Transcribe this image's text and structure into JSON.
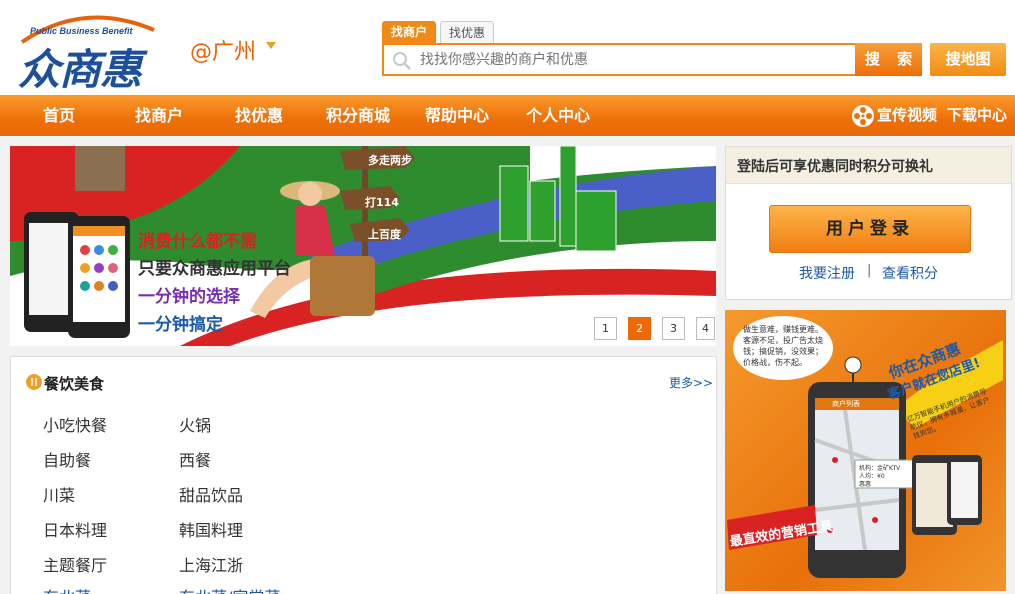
{
  "logo": {
    "english": "Public Business Benefit",
    "chinese": "众商惠"
  },
  "city": {
    "label": "@广州"
  },
  "search": {
    "tabs": [
      {
        "label": "找商户",
        "active": true
      },
      {
        "label": "找优惠",
        "active": false
      }
    ],
    "placeholder": "找找你感兴趣的商户和优惠",
    "button": "搜 索",
    "map_button": "搜地图"
  },
  "nav": {
    "items": [
      "首页",
      "找商户",
      "找优惠",
      "积分商城",
      "帮助中心",
      "个人中心"
    ],
    "right": {
      "video": "宣传视频",
      "download": "下载中心"
    }
  },
  "banner": {
    "signs": [
      "多走两步",
      "打114",
      "上百度"
    ],
    "lines": [
      "消费什么都不需",
      "只要众商惠应用平台",
      "一分钟的选择",
      "一分钟搞定"
    ],
    "pager": [
      "1",
      "2",
      "3",
      "4"
    ],
    "active_page": "2"
  },
  "category": {
    "title": "餐饮美食",
    "more": "更多>>",
    "items": [
      [
        "小吃快餐",
        "火锅"
      ],
      [
        "自助餐",
        "西餐"
      ],
      [
        "川菜",
        "甜品饮品"
      ],
      [
        "日本料理",
        "韩国料理"
      ],
      [
        "主题餐厅",
        "上海江浙"
      ],
      [
        "东北菜",
        "东北菜/家常菜"
      ]
    ]
  },
  "login": {
    "header": "登陆后可享优惠同时积分可换礼",
    "button": "用户登录",
    "register": "我要注册",
    "separator": "|",
    "points": "查看积分"
  },
  "ad": {
    "bubble": "做生意难，赚钱更难。客源不足，投广告太烧钱；搞促销，没效果；价格战，伤不起。",
    "headline1": "你在众商惠",
    "headline2": "客户就在您店里!",
    "body": "亿万智能手机用户的消费导航仪，拥有多城漫，让客户找到您。",
    "slogan": "最直效的营销工具",
    "phone_title": "商户列表",
    "card_line1": "机构：金矿KTV",
    "card_line2": "人均：¥0",
    "card_line3": "惠惠"
  }
}
